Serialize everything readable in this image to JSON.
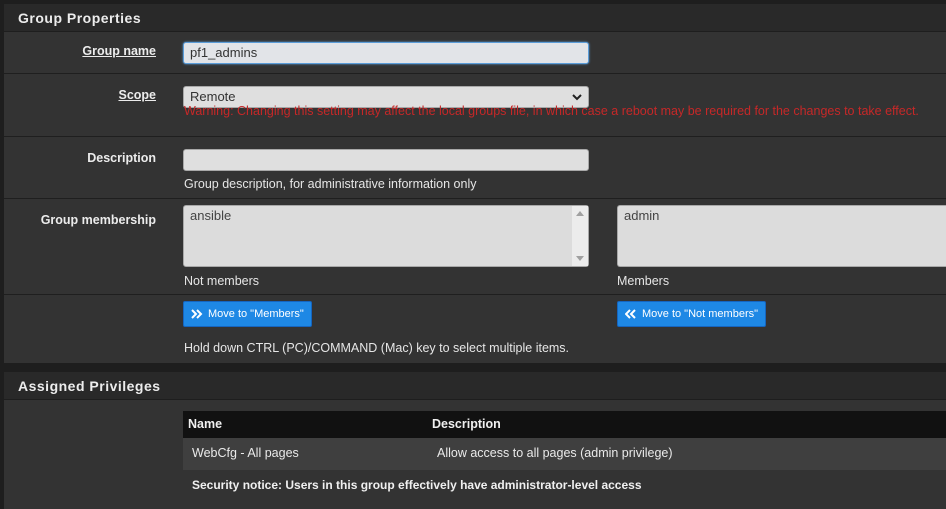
{
  "group_properties": {
    "title": "Group Properties",
    "group_name": {
      "label": "Group name",
      "value": "pf1_admins"
    },
    "scope": {
      "label": "Scope",
      "selected": "Remote",
      "warning": "Warning: Changing this setting may affect the local groups file, in which case a reboot may be required for the changes to take effect."
    },
    "description": {
      "label": "Description",
      "value": "",
      "help": "Group description, for administrative information only"
    },
    "membership": {
      "label": "Group membership",
      "not_members": [
        "ansible"
      ],
      "not_members_caption": "Not members",
      "members": [
        "admin"
      ],
      "members_caption": "Members",
      "move_to_members": "Move to \"Members\"",
      "move_to_not_members": "Move to \"Not members\"",
      "help": "Hold down CTRL (PC)/COMMAND (Mac) key to select multiple items."
    }
  },
  "assigned_privileges": {
    "title": "Assigned Privileges",
    "columns": [
      "Name",
      "Description"
    ],
    "rows": [
      {
        "name": "WebCfg - All pages",
        "description": "Allow access to all pages (admin privilege)"
      }
    ],
    "security_notice": "Security notice: Users in this group effectively have administrator-level access"
  },
  "colors": {
    "accent": "#1e88e5",
    "warning": "#c62828",
    "panel": "#333333",
    "heading": "#292929"
  },
  "icons": {
    "move_right": "double-chevron-right-icon",
    "move_left": "double-chevron-left-icon",
    "select": "chevron-down-icon"
  }
}
